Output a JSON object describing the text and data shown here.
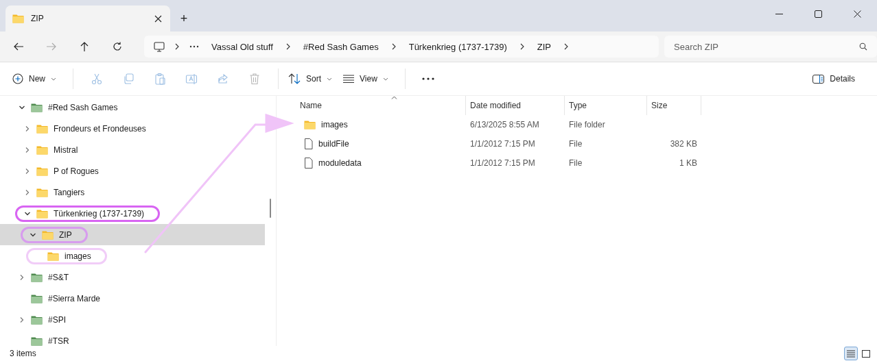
{
  "window": {
    "tab_title": "ZIP",
    "new_tab": "+"
  },
  "nav": [
    {
      "kind": "back",
      "disabled": false
    },
    {
      "kind": "forward",
      "disabled": true
    },
    {
      "kind": "up",
      "disabled": false
    },
    {
      "kind": "refresh",
      "disabled": false
    }
  ],
  "address_bar": {
    "breadcrumbs": [
      "Vassal Old stuff",
      "#Red Sash Games",
      "Türkenkrieg (1737-1739)",
      "ZIP"
    ]
  },
  "search": {
    "placeholder": "Search ZIP"
  },
  "toolbar": {
    "new_label": "New",
    "actions": [
      {
        "kind": "cut",
        "disabled": true
      },
      {
        "kind": "copy",
        "disabled": true
      },
      {
        "kind": "paste",
        "disabled": true
      },
      {
        "kind": "rename",
        "disabled": true
      },
      {
        "kind": "share",
        "disabled": true
      },
      {
        "kind": "delete",
        "disabled": true
      }
    ],
    "sort_label": "Sort",
    "view_label": "View",
    "details_label": "Details"
  },
  "tree": [
    {
      "label": "#Red Sash Games",
      "kind": "library",
      "expanded": true,
      "selected": false,
      "children": [
        {
          "label": "Frondeurs et Frondeuses",
          "kind": "folder",
          "expanded": false,
          "selected": false
        },
        {
          "label": "Mistral",
          "kind": "folder",
          "expanded": false,
          "selected": false
        },
        {
          "label": "P of Rogues",
          "kind": "folder",
          "expanded": false,
          "selected": false
        },
        {
          "label": "Tangiers",
          "kind": "folder",
          "expanded": false,
          "selected": false
        },
        {
          "label": "Türkenkrieg (1737-1739)",
          "kind": "folder",
          "expanded": true,
          "selected": false,
          "color": "#d865f2",
          "children": [
            {
              "label": "ZIP",
              "kind": "folder",
              "expanded": true,
              "selected": true,
              "color": "#d79cee",
              "children": [
                {
                  "label": "images",
                  "kind": "folder",
                  "selected": false,
                  "color": "#f1cdf8"
                }
              ]
            }
          ]
        }
      ]
    },
    {
      "label": "#S&T",
      "kind": "library",
      "expanded": false,
      "selected": false
    },
    {
      "label": "#Sierra Marde",
      "kind": "library",
      "selected": false
    },
    {
      "label": "#SPI",
      "kind": "library",
      "expanded": false,
      "selected": false
    },
    {
      "label": "#TSR",
      "kind": "library",
      "selected": false
    }
  ],
  "file_list": {
    "columns": [
      "Name",
      "Date modified",
      "Type",
      "Size"
    ],
    "rows": [
      {
        "kind": "folder",
        "name": "images",
        "date": "6/13/2025 8:55 AM",
        "type": "File folder"
      },
      {
        "kind": "file",
        "name": "buildFile",
        "date": "1/1/2012 7:15 PM",
        "type": "File",
        "size": "382 KB"
      },
      {
        "kind": "file",
        "name": "moduledata",
        "date": "1/1/2012 7:15 PM",
        "type": "File",
        "size": "1 KB"
      }
    ]
  },
  "annotation": {
    "color": "#f0c4f8"
  },
  "status_bar": {
    "text": "3 items",
    "view_modes": [
      {
        "kind": "details",
        "selected": true
      },
      {
        "kind": "tiles",
        "selected": false
      }
    ]
  }
}
